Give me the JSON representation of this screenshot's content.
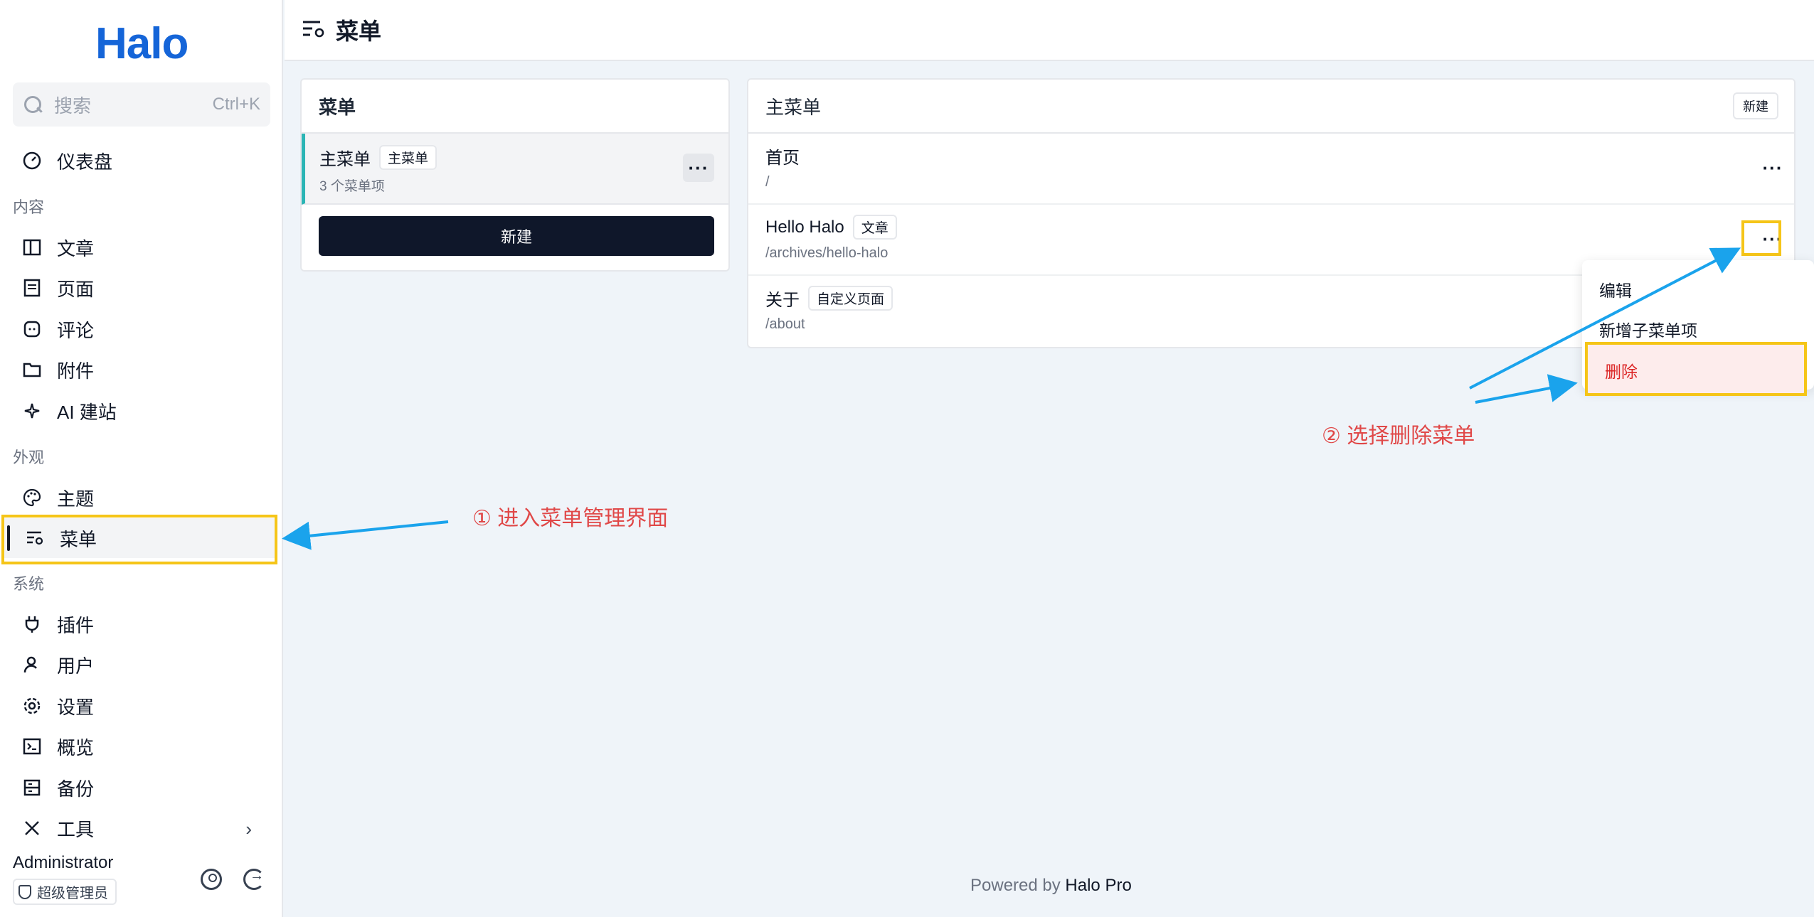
{
  "app": {
    "logo": "Halo"
  },
  "search": {
    "placeholder": "搜索",
    "shortcut": "Ctrl+K"
  },
  "sidebar": {
    "items": [
      {
        "label": "仪表盘",
        "icon": "dashboard-icon"
      },
      {
        "group": "内容"
      },
      {
        "label": "文章",
        "icon": "article-icon"
      },
      {
        "label": "页面",
        "icon": "page-icon"
      },
      {
        "label": "评论",
        "icon": "comment-icon"
      },
      {
        "label": "附件",
        "icon": "folder-icon"
      },
      {
        "label": "AI 建站",
        "icon": "sparkle-icon"
      },
      {
        "group": "外观"
      },
      {
        "label": "主题",
        "icon": "palette-icon"
      },
      {
        "label": "菜单",
        "icon": "menu-settings-icon",
        "active": true
      },
      {
        "group": "系统"
      },
      {
        "label": "插件",
        "icon": "plug-icon"
      },
      {
        "label": "用户",
        "icon": "user-icon"
      },
      {
        "label": "设置",
        "icon": "gear-icon"
      },
      {
        "label": "概览",
        "icon": "terminal-icon"
      },
      {
        "label": "备份",
        "icon": "backup-icon"
      },
      {
        "label": "工具",
        "icon": "tools-icon"
      }
    ],
    "groups": {
      "content": "内容",
      "appearance": "外观",
      "system": "系统"
    },
    "labels": {
      "dashboard": "仪表盘",
      "posts": "文章",
      "pages": "页面",
      "comments": "评论",
      "attachments": "附件",
      "ai": "AI 建站",
      "themes": "主题",
      "menus": "菜单",
      "plugins": "插件",
      "users": "用户",
      "settings": "设置",
      "overview": "概览",
      "backup": "备份",
      "tools": "工具"
    }
  },
  "user": {
    "name": "Administrator",
    "role": "超级管理员"
  },
  "header": {
    "title": "菜单"
  },
  "menus_panel": {
    "title": "菜单",
    "items": [
      {
        "name": "主菜单",
        "tag": "主菜单",
        "count": "3 个菜单项"
      }
    ],
    "new_label": "新建"
  },
  "menu_items_panel": {
    "title": "主菜单",
    "new_label": "新建",
    "rows": [
      {
        "title": "首页",
        "path": "/",
        "tag": ""
      },
      {
        "title": "Hello Halo",
        "path": "/archives/hello-halo",
        "tag": "文章"
      },
      {
        "title": "关于",
        "path": "/about",
        "tag": "自定义页面"
      }
    ]
  },
  "dropdown": {
    "edit": "编辑",
    "add_child": "新增子菜单项",
    "delete": "删除"
  },
  "annotations": {
    "step1": "① 进入菜单管理界面",
    "step2": "② 选择删除菜单"
  },
  "footer": {
    "prefix": "Powered by",
    "brand": "Halo Pro"
  },
  "colors": {
    "accent": "#1565d8",
    "highlight": "#f5c518",
    "arrow": "#1aa3ec",
    "annotation": "#e04848",
    "danger": "#dc2626",
    "primary_button": "#0f172a"
  }
}
